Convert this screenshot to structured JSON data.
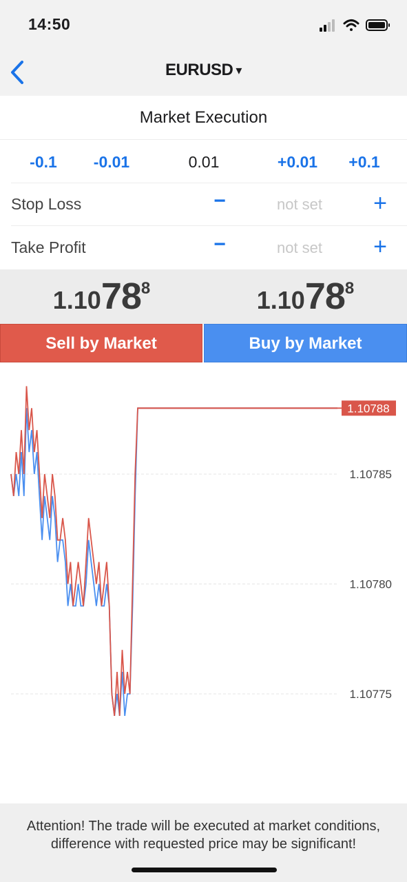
{
  "status_bar": {
    "time": "14:50"
  },
  "nav": {
    "title": "EURUSD",
    "caret": "▾"
  },
  "order": {
    "execution_label": "Market Execution",
    "volume_buttons": [
      "-0.1",
      "-0.01",
      "+0.01",
      "+0.1"
    ],
    "volume_value": "0.01",
    "stop_loss": {
      "label": "Stop Loss",
      "minus": "−",
      "value": "not set",
      "plus": "+"
    },
    "take_profit": {
      "label": "Take Profit",
      "minus": "−",
      "value": "not set",
      "plus": "+"
    }
  },
  "prices": {
    "sell": {
      "small": "1.10",
      "big": "78",
      "sup": "8"
    },
    "buy": {
      "small": "1.10",
      "big": "78",
      "sup": "8"
    }
  },
  "buttons": {
    "sell": "Sell by Market",
    "buy": "Buy by Market"
  },
  "chart_data": {
    "type": "line",
    "ylim": [
      1.1077,
      1.1079
    ],
    "ticks": [
      "1.10785",
      "1.10780",
      "1.10775"
    ],
    "tick_values": [
      1.10785,
      1.1078,
      1.10775
    ],
    "current_label": "1.10788",
    "current_value": 1.10788,
    "grid": true,
    "series": [
      {
        "color": "#d9564a",
        "values": [
          1.10785,
          1.10784,
          1.10786,
          1.10785,
          1.10787,
          1.10785,
          1.10789,
          1.10787,
          1.10788,
          1.10786,
          1.10787,
          1.10785,
          1.10783,
          1.10785,
          1.10784,
          1.10783,
          1.10785,
          1.10784,
          1.10782,
          1.10782,
          1.10783,
          1.10782,
          1.1078,
          1.10781,
          1.10779,
          1.1078,
          1.10781,
          1.1078,
          1.10779,
          1.10781,
          1.10783,
          1.10782,
          1.10781,
          1.1078,
          1.10781,
          1.10779,
          1.1078,
          1.10781,
          1.10779,
          1.10775,
          1.10774,
          1.10776,
          1.10774,
          1.10777,
          1.10775,
          1.10776,
          1.10775,
          1.1078,
          1.10785,
          1.10788,
          1.10788,
          1.10788,
          1.10788,
          1.10788,
          1.10788,
          1.10788,
          1.10788,
          1.10788,
          1.10788,
          1.10788
        ]
      },
      {
        "color": "#4a8ff0",
        "values": [
          1.10785,
          1.10784,
          1.10785,
          1.10784,
          1.10786,
          1.10784,
          1.10788,
          1.10786,
          1.10787,
          1.10785,
          1.10786,
          1.10784,
          1.10782,
          1.10784,
          1.10783,
          1.10782,
          1.10784,
          1.10783,
          1.10781,
          1.10782,
          1.10782,
          1.10781,
          1.10779,
          1.1078,
          1.10779,
          1.10779,
          1.1078,
          1.10779,
          1.10779,
          1.1078,
          1.10782,
          1.10781,
          1.1078,
          1.10779,
          1.1078,
          1.10779,
          1.10779,
          1.1078,
          1.10779,
          1.10775,
          1.10774,
          1.10775,
          1.10774,
          1.10776,
          1.10774,
          1.10775,
          1.10775,
          1.10779,
          1.10784,
          1.10788,
          1.10788,
          1.10788,
          1.10788,
          1.10788,
          1.10788,
          1.10788,
          1.10788,
          1.10788,
          1.10788,
          1.10788
        ]
      }
    ]
  },
  "footer": {
    "warning": "Attention! The trade will be executed at market conditions, difference with requested price may be significant!"
  }
}
